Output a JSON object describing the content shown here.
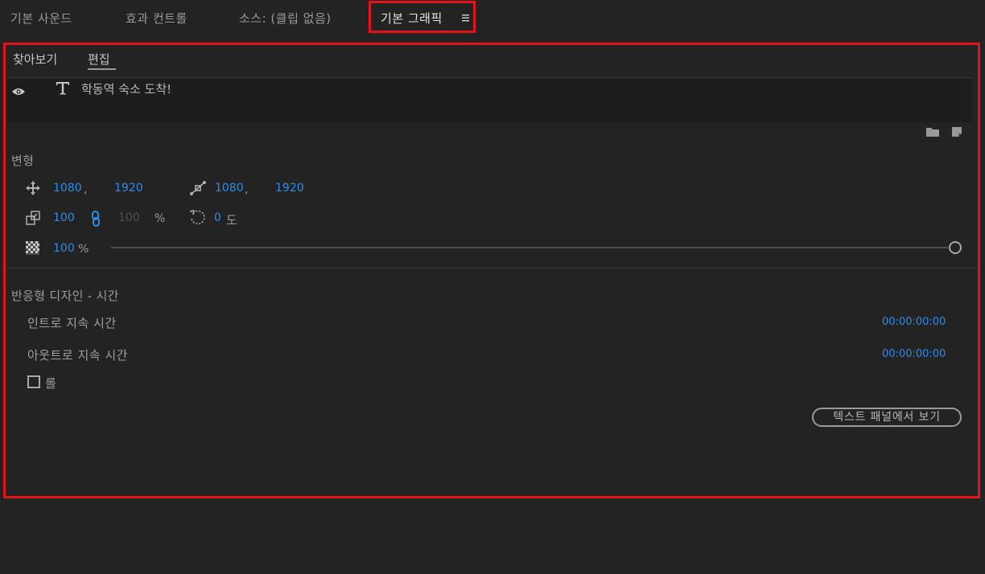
{
  "tabs": [
    {
      "label": "기본 사운드"
    },
    {
      "label": "효과 컨트롤"
    },
    {
      "label": "소스: (클립 없음)"
    },
    {
      "label": "기본 그래픽"
    }
  ],
  "subtabs": {
    "browse": "찾아보기",
    "edit": "편집"
  },
  "layer": {
    "text": "학동역 숙소 도착!"
  },
  "transform": {
    "label": "변형",
    "position_x": "1080",
    "position_y": "1920",
    "position_sep": ",",
    "anchor_x": "1080",
    "anchor_y": "1920",
    "anchor_sep": ",",
    "scale": "100",
    "scale_height": "100",
    "scale_unit": "%",
    "rotation": "0",
    "rotation_unit": "도",
    "opacity": "100",
    "opacity_unit": "%"
  },
  "responsive": {
    "label": "반응형 디자인 - 시간",
    "intro_label": "인트로 지속 시간",
    "intro_value": "00:00:00:00",
    "outro_label": "아웃트로 지속 시간",
    "outro_value": "00:00:00:00",
    "roll_label": "롤"
  },
  "text_panel_button": "텍스트 패널에서 보기",
  "colors": {
    "accent": "#2d8ceb",
    "highlight": "#e3141e",
    "background": "#232323"
  },
  "icons": [
    "menu-icon",
    "eye-icon",
    "text-tool-icon",
    "folder-icon",
    "new-item-icon",
    "position-icon",
    "anchor-point-icon",
    "scale-icon",
    "link-icon",
    "rotation-icon",
    "opacity-icon"
  ]
}
